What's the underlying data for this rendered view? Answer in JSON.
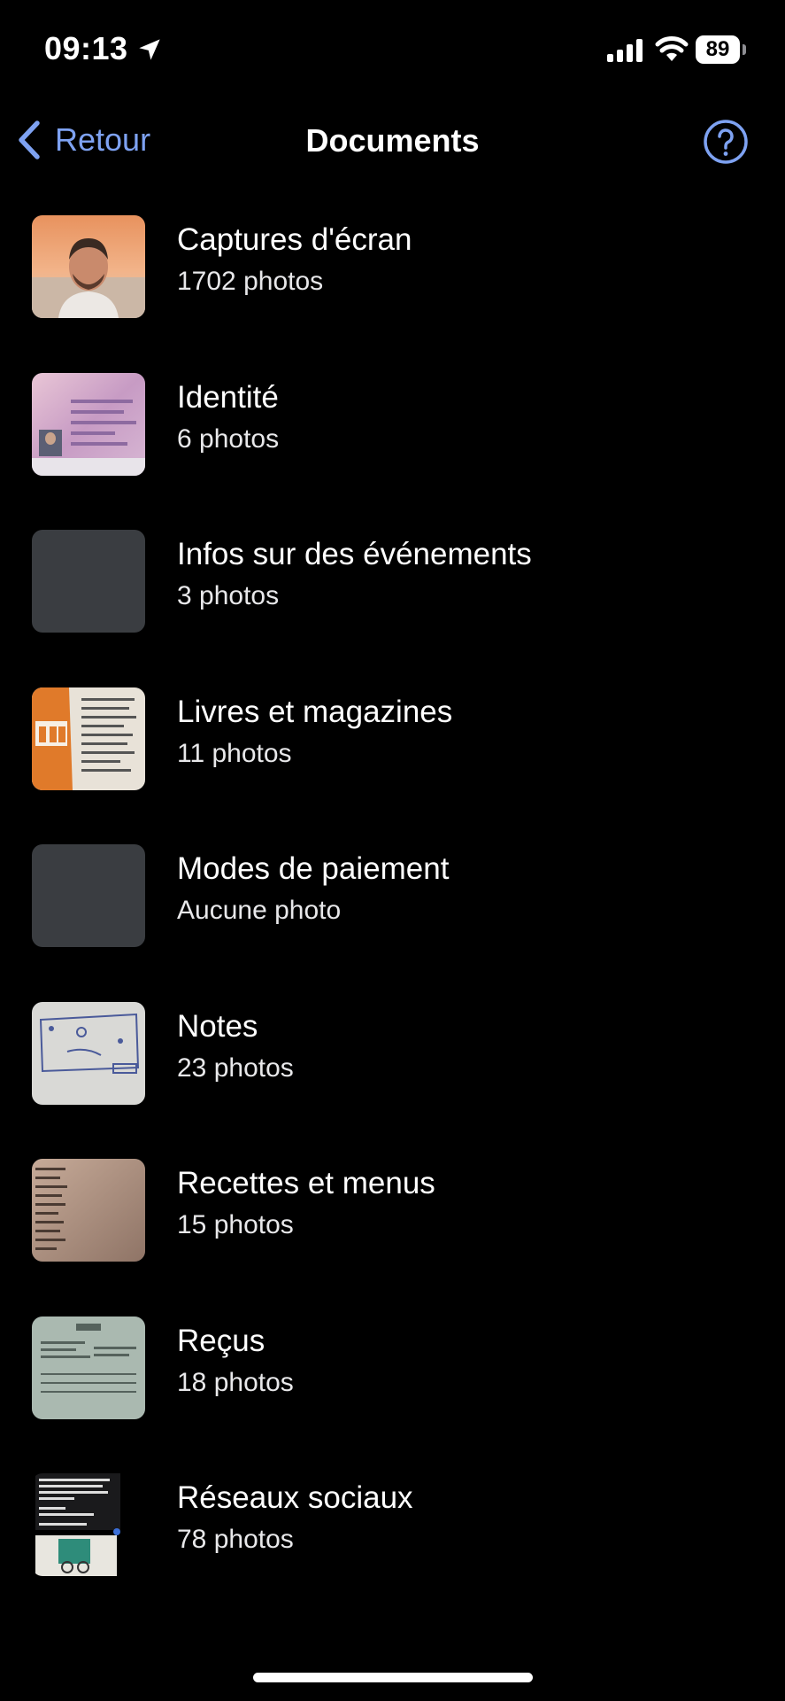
{
  "status_bar": {
    "time": "09:13",
    "battery": "89"
  },
  "nav": {
    "back_label": "Retour",
    "title": "Documents"
  },
  "albums": [
    {
      "name": "Captures d'écran",
      "count": "1702 photos"
    },
    {
      "name": "Identité",
      "count": "6 photos"
    },
    {
      "name": "Infos sur des événements",
      "count": "3 photos"
    },
    {
      "name": "Livres et magazines",
      "count": "11 photos"
    },
    {
      "name": "Modes de paiement",
      "count": "Aucune photo"
    },
    {
      "name": "Notes",
      "count": "23 photos"
    },
    {
      "name": "Recettes et menus",
      "count": "15 photos"
    },
    {
      "name": "Reçus",
      "count": "18 photos"
    },
    {
      "name": "Réseaux sociaux",
      "count": "78 photos"
    }
  ],
  "colors": {
    "background": "#000000",
    "accent": "#7ea2f2",
    "placeholder_thumb": "#3a3d41"
  }
}
